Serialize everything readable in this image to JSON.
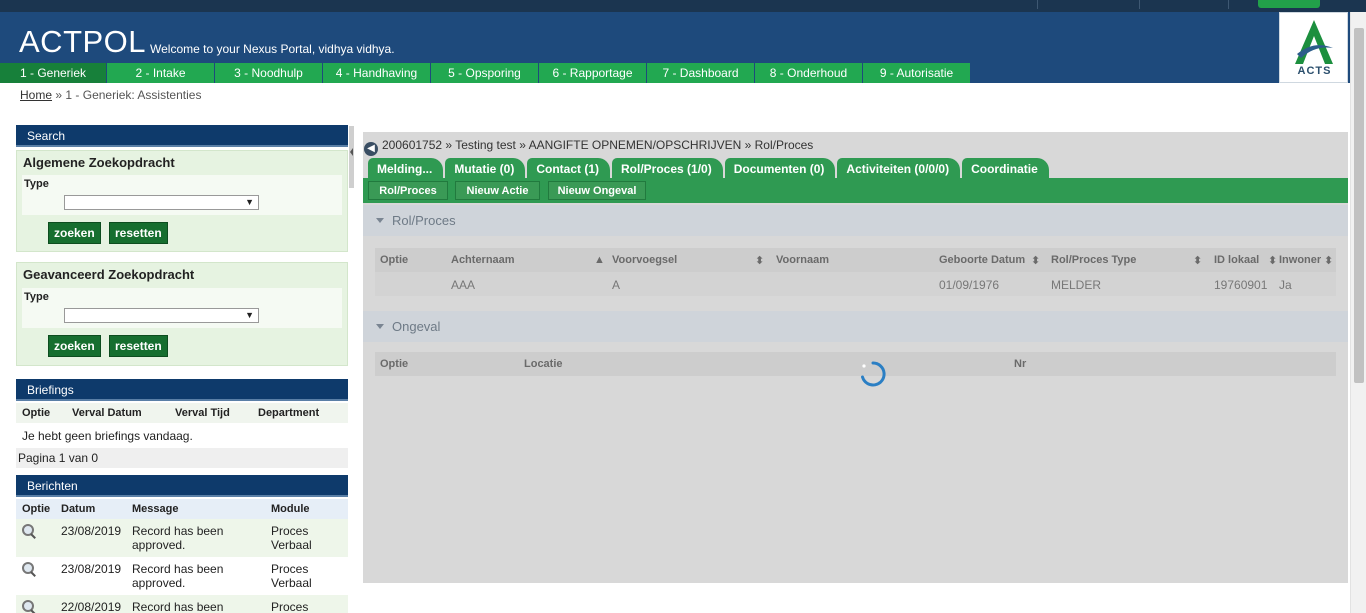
{
  "header": {
    "brand": "ACTPOL",
    "welcome": "Welcome to your Nexus Portal, vidhya vidhya.",
    "logo_text": "ACTS"
  },
  "nav": [
    {
      "label": "1 - Generiek"
    },
    {
      "label": "2 - Intake"
    },
    {
      "label": "3 - Noodhulp"
    },
    {
      "label": "4 - Handhaving"
    },
    {
      "label": "5 - Opsporing"
    },
    {
      "label": "6 - Rapportage"
    },
    {
      "label": "7 - Dashboard"
    },
    {
      "label": "8 - Onderhoud"
    },
    {
      "label": "9 - Autorisatie"
    }
  ],
  "breadcrumb": {
    "home": "Home",
    "separator": "»",
    "current": "1 - Generiek: Assistenties"
  },
  "search": {
    "title": "Search",
    "basic": {
      "title": "Algemene Zoekopdracht",
      "type_label": "Type",
      "search_label": "zoeken",
      "reset_label": "resetten"
    },
    "advanced": {
      "title": "Geavanceerd Zoekopdracht",
      "type_label": "Type",
      "search_label": "zoeken",
      "reset_label": "resetten"
    }
  },
  "briefings": {
    "title": "Briefings",
    "columns": [
      "Optie",
      "Verval Datum",
      "Verval Tijd",
      "Department"
    ],
    "empty": "Je hebt geen briefings vandaag.",
    "pager": "Pagina 1 van 0"
  },
  "berichten": {
    "title": "Berichten",
    "columns": [
      "Optie",
      "Datum",
      "Message",
      "Module"
    ],
    "rows": [
      {
        "date": "23/08/2019",
        "message": "Record has been approved.",
        "module": "Proces Verbaal"
      },
      {
        "date": "23/08/2019",
        "message": "Record has been approved.",
        "module": "Proces Verbaal"
      },
      {
        "date": "22/08/2019",
        "message": "Record has been",
        "module": "Proces"
      }
    ]
  },
  "main": {
    "crumb": "200601752 » Testing test » AANGIFTE OPNEMEN/OPSCHRIJVEN » Rol/Proces",
    "tabs": [
      "Melding...",
      "Mutatie (0)",
      "Contact (1)",
      "Rol/Proces (1/0)",
      "Documenten (0)",
      "Activiteiten (0/0/0)",
      "Coordinatie"
    ],
    "actions": [
      "Rol/Proces",
      "Nieuw Actie",
      "Nieuw Ongeval"
    ],
    "rolproces": {
      "title": "Rol/Proces",
      "columns": [
        "Optie",
        "Achternaam",
        "Voorvoegsel",
        "Voornaam",
        "Geboorte Datum",
        "Rol/Proces Type",
        "ID lokaal",
        "Inwoner"
      ],
      "row": {
        "optie": "",
        "achternaam": "AAA",
        "voorvoegsel": "A",
        "voornaam": "",
        "geboorte": "01/09/1976",
        "type": "MELDER",
        "id": "19760901",
        "inwoner": "Ja"
      }
    },
    "ongeval": {
      "title": "Ongeval",
      "columns": [
        "Optie",
        "Locatie",
        "Nr"
      ]
    }
  }
}
